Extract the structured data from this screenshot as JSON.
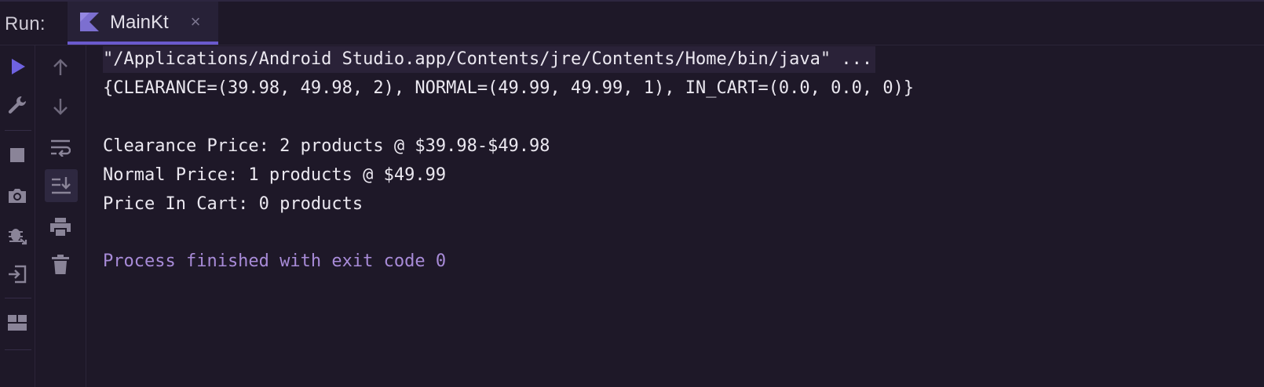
{
  "header": {
    "run_label": "Run:",
    "tab": {
      "label": "MainKt",
      "icon": "kotlin-icon",
      "close_glyph": "×"
    }
  },
  "toolbar_left": [
    {
      "name": "run-icon"
    },
    {
      "name": "wrench-icon"
    },
    {
      "name": "stop-icon"
    },
    {
      "name": "camera-icon"
    },
    {
      "name": "debug-icon"
    },
    {
      "name": "exit-icon"
    },
    {
      "name": "layout-icon"
    }
  ],
  "toolbar_right": [
    {
      "name": "up-arrow-icon"
    },
    {
      "name": "down-arrow-icon"
    },
    {
      "name": "soft-wrap-icon"
    },
    {
      "name": "scroll-to-end-icon"
    },
    {
      "name": "print-icon"
    },
    {
      "name": "trash-icon"
    }
  ],
  "console": {
    "lines": [
      "\"/Applications/Android Studio.app/Contents/jre/Contents/Home/bin/java\" ...",
      "{CLEARANCE=(39.98, 49.98, 2), NORMAL=(49.99, 49.99, 1), IN_CART=(0.0, 0.0, 0)}",
      "",
      "Clearance Price: 2 products @ $39.98-$49.98",
      "Normal Price: 1 products @ $49.99",
      "Price In Cart: 0 products",
      "",
      "Process finished with exit code 0"
    ]
  },
  "colors": {
    "background": "#1e1828",
    "accent": "#6a5acd",
    "exit_text": "#a88bd8",
    "icon": "#8a8498"
  }
}
